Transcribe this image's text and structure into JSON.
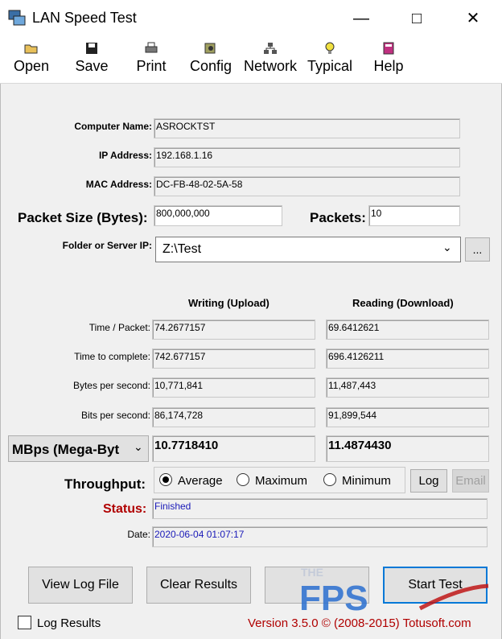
{
  "window": {
    "title": "LAN Speed Test"
  },
  "toolbar": [
    {
      "label": "Open",
      "icon": "open-folder-icon"
    },
    {
      "label": "Save",
      "icon": "floppy-disk-icon"
    },
    {
      "label": "Print",
      "icon": "printer-icon"
    },
    {
      "label": "Config",
      "icon": "config-icon"
    },
    {
      "label": "Network",
      "icon": "network-icon"
    },
    {
      "label": "Typical",
      "icon": "lightbulb-icon"
    },
    {
      "label": "Help",
      "icon": "help-book-icon"
    }
  ],
  "info": {
    "computer_name_label": "Computer Name:",
    "computer_name": "ASROCKTST",
    "ip_label": "IP Address:",
    "ip": "192.168.1.16",
    "mac_label": "MAC Address:",
    "mac": "DC-FB-48-02-5A-58",
    "packet_size_label": "Packet Size (Bytes):",
    "packet_size": "800,000,000",
    "packets_label": "Packets:",
    "packets": "10",
    "folder_label": "Folder or Server IP:",
    "folder": "Z:\\Test",
    "browse_label": "..."
  },
  "results": {
    "writing_header": "Writing (Upload)",
    "reading_header": "Reading (Download)",
    "rows": [
      {
        "label": "Time / Packet:",
        "write": "74.2677157",
        "read": "69.6412621"
      },
      {
        "label": "Time to complete:",
        "write": "742.677157",
        "read": "696.4126211"
      },
      {
        "label": "Bytes per second:",
        "write": "10,771,841",
        "read": "11,487,443"
      },
      {
        "label": "Bits per second:",
        "write": "86,174,728",
        "read": "91,899,544"
      }
    ],
    "unit_select": "MBps (Mega-Byt",
    "write_mbps": "10.7718410",
    "read_mbps": "11.4874430"
  },
  "throughput": {
    "label": "Throughput:",
    "options": [
      "Average",
      "Maximum",
      "Minimum"
    ],
    "selected": "Average",
    "log_label": "Log",
    "email_label": "Email"
  },
  "status": {
    "label": "Status:",
    "value": "Finished",
    "date_label": "Date:",
    "date": "2020-06-04 01:07:17"
  },
  "buttons": {
    "view_log": "View Log File",
    "clear": "Clear Results",
    "start": "Start Test"
  },
  "footer": {
    "log_results": "Log Results",
    "version": "Version 3.5.0  ©  (2008-2015) Totusoft.com"
  },
  "watermark": {
    "text": "THE FPS REVIEW"
  },
  "colors": {
    "status_red": "#b00000",
    "link_blue": "#1a1ab8",
    "footer_red": "#b00000"
  }
}
